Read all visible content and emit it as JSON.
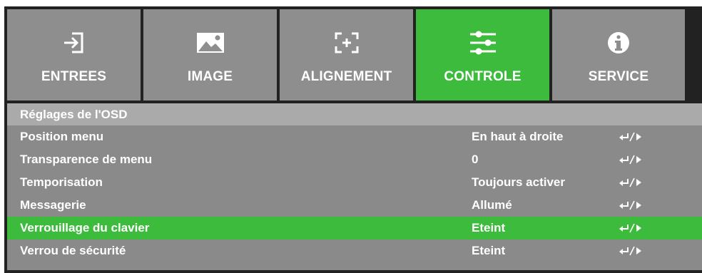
{
  "tabs": [
    {
      "label": "ENTREES",
      "icon": "input-icon",
      "active": false
    },
    {
      "label": "IMAGE",
      "icon": "image-icon",
      "active": false
    },
    {
      "label": "ALIGNEMENT",
      "icon": "alignment-icon",
      "active": false
    },
    {
      "label": "CONTROLE",
      "icon": "sliders-icon",
      "active": true
    },
    {
      "label": "SERVICE",
      "icon": "info-icon",
      "active": false
    }
  ],
  "section": {
    "title": "Réglages de l'OSD"
  },
  "rows": [
    {
      "label": "Position menu",
      "value": "En haut à droite",
      "control": "enter-or-right-arrow-icon"
    },
    {
      "label": "Transparence de menu",
      "value": "0",
      "control": "enter-or-right-arrow-icon"
    },
    {
      "label": "Temporisation",
      "value": "Toujours activer",
      "control": "enter-or-right-arrow-icon"
    },
    {
      "label": "Messagerie",
      "value": "Allumé",
      "control": "enter-or-right-arrow-icon"
    },
    {
      "label": "Verrouillage du clavier",
      "value": "Eteint",
      "control": "enter-or-right-arrow-icon",
      "selected": true
    },
    {
      "label": "Verrou de sécurité",
      "value": "Eteint",
      "control": "enter-or-right-arrow-icon"
    }
  ],
  "colors": {
    "active_tab": "#3dbb3d",
    "inactive_tab": "#8e8e8e",
    "section_bar": "#aaaaaa",
    "menu_bg": "#8a8a8a",
    "frame": "#222222",
    "text": "#ffffff"
  }
}
